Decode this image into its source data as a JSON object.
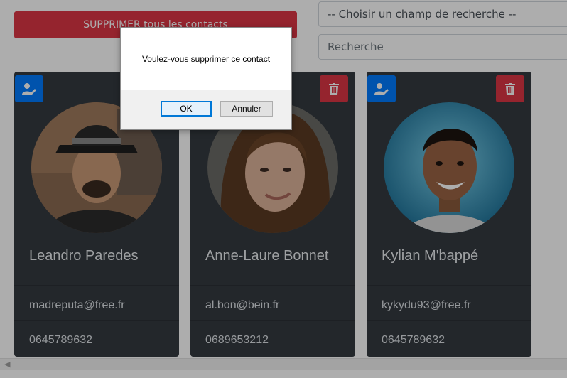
{
  "toolbar": {
    "delete_all_label": "SUPPRIMER tous les contacts",
    "search_field_select": "-- Choisir un champ de recherche --",
    "search_placeholder": "Recherche"
  },
  "contacts": [
    {
      "name": "Leandro Paredes",
      "email": "madreputa@free.fr",
      "phone": "0645789632"
    },
    {
      "name": "Anne-Laure Bonnet",
      "email": "al.bon@bein.fr",
      "phone": "0689653212"
    },
    {
      "name": "Kylian M'bappé",
      "email": "kykydu93@free.fr",
      "phone": "0645789632"
    }
  ],
  "dialog": {
    "message": "Voulez-vous supprimer ce contact",
    "ok_label": "OK",
    "cancel_label": "Annuler"
  },
  "icons": {
    "edit": "user-edit-icon",
    "delete": "trash-icon"
  },
  "colors": {
    "danger": "#dc3545",
    "primary": "#007bff",
    "card_bg": "#343a40"
  }
}
